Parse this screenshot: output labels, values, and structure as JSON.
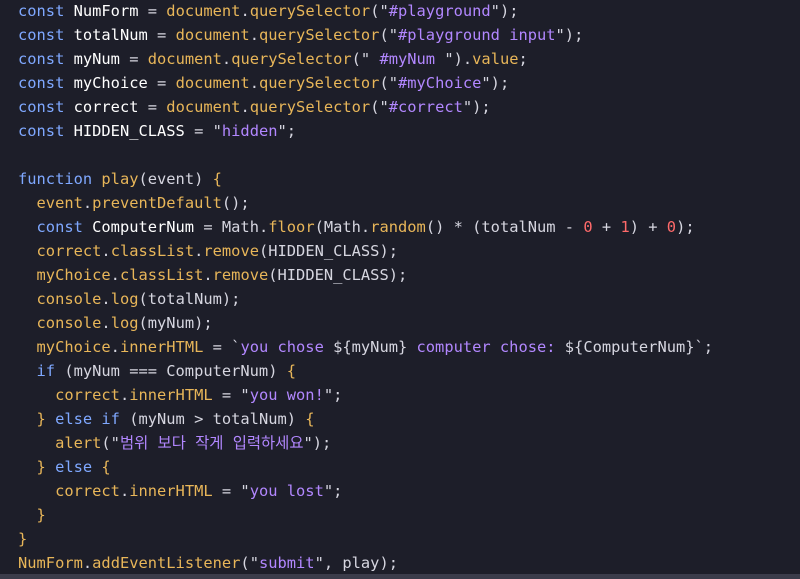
{
  "colors": {
    "background": "#1d1e29",
    "keyword": "#7fa8ff",
    "variable": "#ffffff",
    "plain": "#d6d6e0",
    "property": "#e8b659",
    "method": "#b287ff",
    "string_quote": "#d6d6e0",
    "string_text": "#b287ff",
    "number": "#ff6a6a",
    "punct": "#d6d6e0"
  },
  "code_lines": [
    [
      {
        "t": "const ",
        "c": "keyword"
      },
      {
        "t": "NumForm",
        "c": "variable"
      },
      {
        "t": " = ",
        "c": "plain"
      },
      {
        "t": "document",
        "c": "property"
      },
      {
        "t": ".",
        "c": "plain"
      },
      {
        "t": "querySelector",
        "c": "property"
      },
      {
        "t": "(\"",
        "c": "plain"
      },
      {
        "t": "#playground",
        "c": "method"
      },
      {
        "t": "\");",
        "c": "plain"
      }
    ],
    [
      {
        "t": "const ",
        "c": "keyword"
      },
      {
        "t": "totalNum",
        "c": "variable"
      },
      {
        "t": " = ",
        "c": "plain"
      },
      {
        "t": "document",
        "c": "property"
      },
      {
        "t": ".",
        "c": "plain"
      },
      {
        "t": "querySelector",
        "c": "property"
      },
      {
        "t": "(\"",
        "c": "plain"
      },
      {
        "t": "#playground input",
        "c": "method"
      },
      {
        "t": "\");",
        "c": "plain"
      }
    ],
    [
      {
        "t": "const ",
        "c": "keyword"
      },
      {
        "t": "myNum",
        "c": "variable"
      },
      {
        "t": " = ",
        "c": "plain"
      },
      {
        "t": "document",
        "c": "property"
      },
      {
        "t": ".",
        "c": "plain"
      },
      {
        "t": "querySelector",
        "c": "property"
      },
      {
        "t": "(\"",
        "c": "plain"
      },
      {
        "t": " #myNum ",
        "c": "method"
      },
      {
        "t": "\").",
        "c": "plain"
      },
      {
        "t": "value",
        "c": "property"
      },
      {
        "t": ";",
        "c": "plain"
      }
    ],
    [
      {
        "t": "const ",
        "c": "keyword"
      },
      {
        "t": "myChoice",
        "c": "variable"
      },
      {
        "t": " = ",
        "c": "plain"
      },
      {
        "t": "document",
        "c": "property"
      },
      {
        "t": ".",
        "c": "plain"
      },
      {
        "t": "querySelector",
        "c": "property"
      },
      {
        "t": "(\"",
        "c": "plain"
      },
      {
        "t": "#myChoice",
        "c": "method"
      },
      {
        "t": "\");",
        "c": "plain"
      }
    ],
    [
      {
        "t": "const ",
        "c": "keyword"
      },
      {
        "t": "correct",
        "c": "variable"
      },
      {
        "t": " = ",
        "c": "plain"
      },
      {
        "t": "document",
        "c": "property"
      },
      {
        "t": ".",
        "c": "plain"
      },
      {
        "t": "querySelector",
        "c": "property"
      },
      {
        "t": "(\"",
        "c": "plain"
      },
      {
        "t": "#correct",
        "c": "method"
      },
      {
        "t": "\");",
        "c": "plain"
      }
    ],
    [
      {
        "t": "const ",
        "c": "keyword"
      },
      {
        "t": "HIDDEN_CLASS",
        "c": "variable"
      },
      {
        "t": " = \"",
        "c": "plain"
      },
      {
        "t": "hidden",
        "c": "method"
      },
      {
        "t": "\";",
        "c": "plain"
      }
    ],
    [],
    [
      {
        "t": "function ",
        "c": "keyword"
      },
      {
        "t": "play",
        "c": "property"
      },
      {
        "t": "(event) ",
        "c": "plain"
      },
      {
        "t": "{",
        "c": "property"
      }
    ],
    [
      {
        "t": "  event",
        "c": "property"
      },
      {
        "t": ".",
        "c": "plain"
      },
      {
        "t": "preventDefault",
        "c": "property"
      },
      {
        "t": "();",
        "c": "plain"
      }
    ],
    [
      {
        "t": "  const ",
        "c": "keyword"
      },
      {
        "t": "ComputerNum",
        "c": "variable"
      },
      {
        "t": " = ",
        "c": "plain"
      },
      {
        "t": "Math",
        "c": "plain"
      },
      {
        "t": ".",
        "c": "plain"
      },
      {
        "t": "floor",
        "c": "property"
      },
      {
        "t": "(Math.",
        "c": "plain"
      },
      {
        "t": "random",
        "c": "property"
      },
      {
        "t": "() * (totalNum - ",
        "c": "plain"
      },
      {
        "t": "0",
        "c": "number"
      },
      {
        "t": " + ",
        "c": "plain"
      },
      {
        "t": "1",
        "c": "number"
      },
      {
        "t": ") + ",
        "c": "plain"
      },
      {
        "t": "0",
        "c": "number"
      },
      {
        "t": ");",
        "c": "plain"
      }
    ],
    [
      {
        "t": "  correct",
        "c": "property"
      },
      {
        "t": ".",
        "c": "plain"
      },
      {
        "t": "classList",
        "c": "property"
      },
      {
        "t": ".",
        "c": "plain"
      },
      {
        "t": "remove",
        "c": "property"
      },
      {
        "t": "(HIDDEN_CLASS);",
        "c": "plain"
      }
    ],
    [
      {
        "t": "  myChoice",
        "c": "property"
      },
      {
        "t": ".",
        "c": "plain"
      },
      {
        "t": "classList",
        "c": "property"
      },
      {
        "t": ".",
        "c": "plain"
      },
      {
        "t": "remove",
        "c": "property"
      },
      {
        "t": "(HIDDEN_CLASS);",
        "c": "plain"
      }
    ],
    [
      {
        "t": "  console",
        "c": "property"
      },
      {
        "t": ".",
        "c": "plain"
      },
      {
        "t": "log",
        "c": "property"
      },
      {
        "t": "(totalNum);",
        "c": "plain"
      }
    ],
    [
      {
        "t": "  console",
        "c": "property"
      },
      {
        "t": ".",
        "c": "plain"
      },
      {
        "t": "log",
        "c": "property"
      },
      {
        "t": "(myNum);",
        "c": "plain"
      }
    ],
    [
      {
        "t": "  myChoice",
        "c": "property"
      },
      {
        "t": ".",
        "c": "plain"
      },
      {
        "t": "innerHTML",
        "c": "property"
      },
      {
        "t": " = `",
        "c": "plain"
      },
      {
        "t": "you chose ",
        "c": "method"
      },
      {
        "t": "${myNum}",
        "c": "plain"
      },
      {
        "t": " computer chose: ",
        "c": "method"
      },
      {
        "t": "${ComputerNum}",
        "c": "plain"
      },
      {
        "t": "`;",
        "c": "plain"
      }
    ],
    [
      {
        "t": "  if ",
        "c": "keyword"
      },
      {
        "t": "(myNum === ComputerNum) ",
        "c": "plain"
      },
      {
        "t": "{",
        "c": "property"
      }
    ],
    [
      {
        "t": "    correct",
        "c": "property"
      },
      {
        "t": ".",
        "c": "plain"
      },
      {
        "t": "innerHTML",
        "c": "property"
      },
      {
        "t": " = \"",
        "c": "plain"
      },
      {
        "t": "you won!",
        "c": "method"
      },
      {
        "t": "\";",
        "c": "plain"
      }
    ],
    [
      {
        "t": "  } ",
        "c": "property"
      },
      {
        "t": "else if ",
        "c": "keyword"
      },
      {
        "t": "(myNum > totalNum) ",
        "c": "plain"
      },
      {
        "t": "{",
        "c": "property"
      }
    ],
    [
      {
        "t": "    alert",
        "c": "property"
      },
      {
        "t": "(\"",
        "c": "plain"
      },
      {
        "t": "범위 보다 작게 입력하세요",
        "c": "method"
      },
      {
        "t": "\");",
        "c": "plain"
      }
    ],
    [
      {
        "t": "  } ",
        "c": "property"
      },
      {
        "t": "else ",
        "c": "keyword"
      },
      {
        "t": "{",
        "c": "property"
      }
    ],
    [
      {
        "t": "    correct",
        "c": "property"
      },
      {
        "t": ".",
        "c": "plain"
      },
      {
        "t": "innerHTML",
        "c": "property"
      },
      {
        "t": " = \"",
        "c": "plain"
      },
      {
        "t": "you lost",
        "c": "method"
      },
      {
        "t": "\";",
        "c": "plain"
      }
    ],
    [
      {
        "t": "  }",
        "c": "property"
      }
    ],
    [
      {
        "t": "}",
        "c": "property"
      }
    ],
    [
      {
        "t": "NumForm",
        "c": "property"
      },
      {
        "t": ".",
        "c": "plain"
      },
      {
        "t": "addEventListener",
        "c": "property"
      },
      {
        "t": "(\"",
        "c": "plain"
      },
      {
        "t": "submit",
        "c": "method"
      },
      {
        "t": "\", play);",
        "c": "plain"
      }
    ]
  ]
}
